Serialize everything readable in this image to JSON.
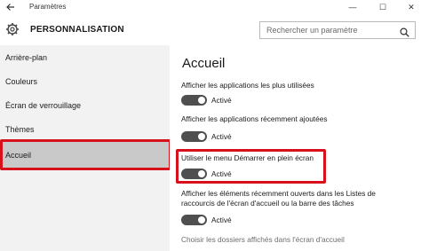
{
  "window": {
    "title": "Paramètres",
    "back_icon": "back-arrow-icon",
    "minimize": "—",
    "maximize": "☐",
    "close": "✕"
  },
  "header": {
    "section_title": "PERSONNALISATION",
    "section_icon": "gear-icon"
  },
  "search": {
    "placeholder": "Rechercher un paramètre",
    "icon": "search-icon"
  },
  "sidebar": {
    "items": [
      {
        "label": "Arrière-plan"
      },
      {
        "label": "Couleurs"
      },
      {
        "label": "Écran de verrouillage"
      },
      {
        "label": "Thèmes"
      },
      {
        "label": "Accueil",
        "selected": true
      }
    ]
  },
  "main": {
    "title": "Accueil",
    "settings": [
      {
        "label": "Afficher les applications les plus utilisées",
        "state": "Activé",
        "on": true
      },
      {
        "label": "Afficher les applications récemment ajoutées",
        "state": "Activé",
        "on": true
      },
      {
        "label": "Utiliser le menu Démarrer en plein écran",
        "state": "Activé",
        "on": true,
        "highlighted": true
      },
      {
        "label_line1": "Afficher les éléments récemment ouverts dans les Listes de",
        "label_line2": "raccourcis de l'écran d'accueil ou la barre des tâches",
        "state": "Activé",
        "on": true
      }
    ],
    "link": "Choisir les dossiers affichés dans l'écran d'accueil"
  },
  "colors": {
    "highlight": "#d8101c",
    "toggle_on": "#4f4f4f",
    "sidebar_bg": "#f2f2f2",
    "selected_bg": "#c9c9c9"
  }
}
